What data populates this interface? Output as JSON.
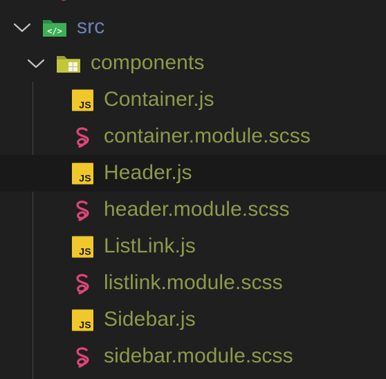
{
  "colors": {
    "background": "#1f1f1f",
    "folder_text_src": "#6b84b3",
    "folder_text": "#8d9a4b",
    "file_text": "#8d9a4b",
    "js_icon": "#f1c82b",
    "sass_icon": "#e0457b",
    "src_folder_icon": "#3daf57",
    "components_folder_icon": "#c2c63b",
    "hover_row": "#191919",
    "chevron": "#c5c5c5",
    "indent_guide": "#454545"
  },
  "tree": {
    "src": {
      "label": "src",
      "expanded": true,
      "icon": "folder-src-open-icon"
    },
    "components": {
      "label": "components",
      "expanded": true,
      "icon": "folder-components-open-icon"
    },
    "files": [
      {
        "label": "Container.js",
        "icon": "javascript-icon",
        "icon_text": "JS"
      },
      {
        "label": "container.module.scss",
        "icon": "sass-icon"
      },
      {
        "label": "Header.js",
        "icon": "javascript-icon",
        "icon_text": "JS",
        "hovered": true
      },
      {
        "label": "header.module.scss",
        "icon": "sass-icon"
      },
      {
        "label": "ListLink.js",
        "icon": "javascript-icon",
        "icon_text": "JS"
      },
      {
        "label": "listlink.module.scss",
        "icon": "sass-icon"
      },
      {
        "label": "Sidebar.js",
        "icon": "javascript-icon",
        "icon_text": "JS"
      },
      {
        "label": "sidebar.module.scss",
        "icon": "sass-icon"
      }
    ]
  }
}
